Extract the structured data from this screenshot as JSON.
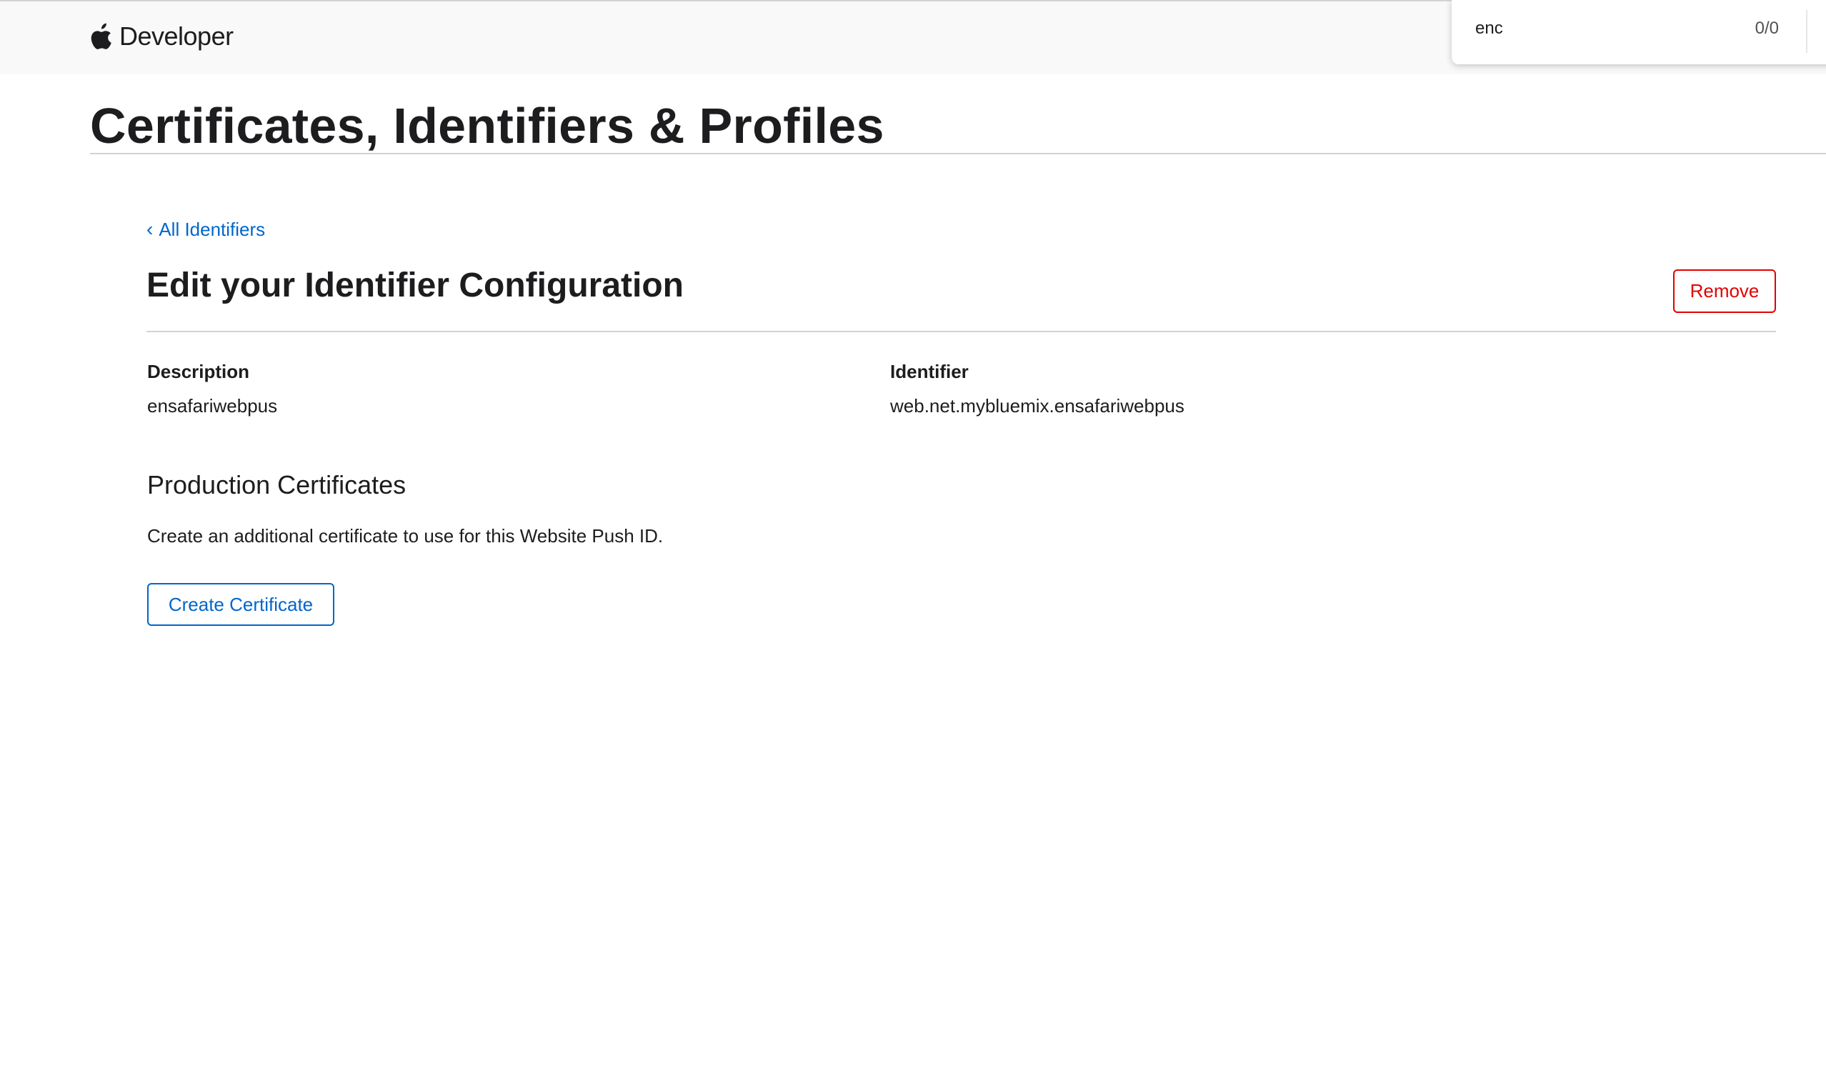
{
  "nav": {
    "brand": "Developer",
    "logo_icon": "apple-logo-icon"
  },
  "find_bar": {
    "query": "enc",
    "match_count": "0/0",
    "prev_icon": "chevron-left-icon"
  },
  "page": {
    "title": "Certificates, Identifiers & Profiles"
  },
  "breadcrumb": {
    "back_label": "All Identifiers",
    "back_icon": "chevron-left-icon"
  },
  "identifier_config": {
    "title": "Edit your Identifier Configuration",
    "remove_label": "Remove",
    "description_label": "Description",
    "description_value": "ensafariwebpus",
    "identifier_label": "Identifier",
    "identifier_value": "web.net.mybluemix.ensafariwebpus"
  },
  "production_certificates": {
    "title": "Production Certificates",
    "description": "Create an additional certificate to use for this Website Push ID.",
    "create_label": "Create Certificate"
  },
  "colors": {
    "link": "#0066cc",
    "danger": "#e30000",
    "text": "#1d1d1f",
    "nav_bg": "#f9f9f9"
  }
}
